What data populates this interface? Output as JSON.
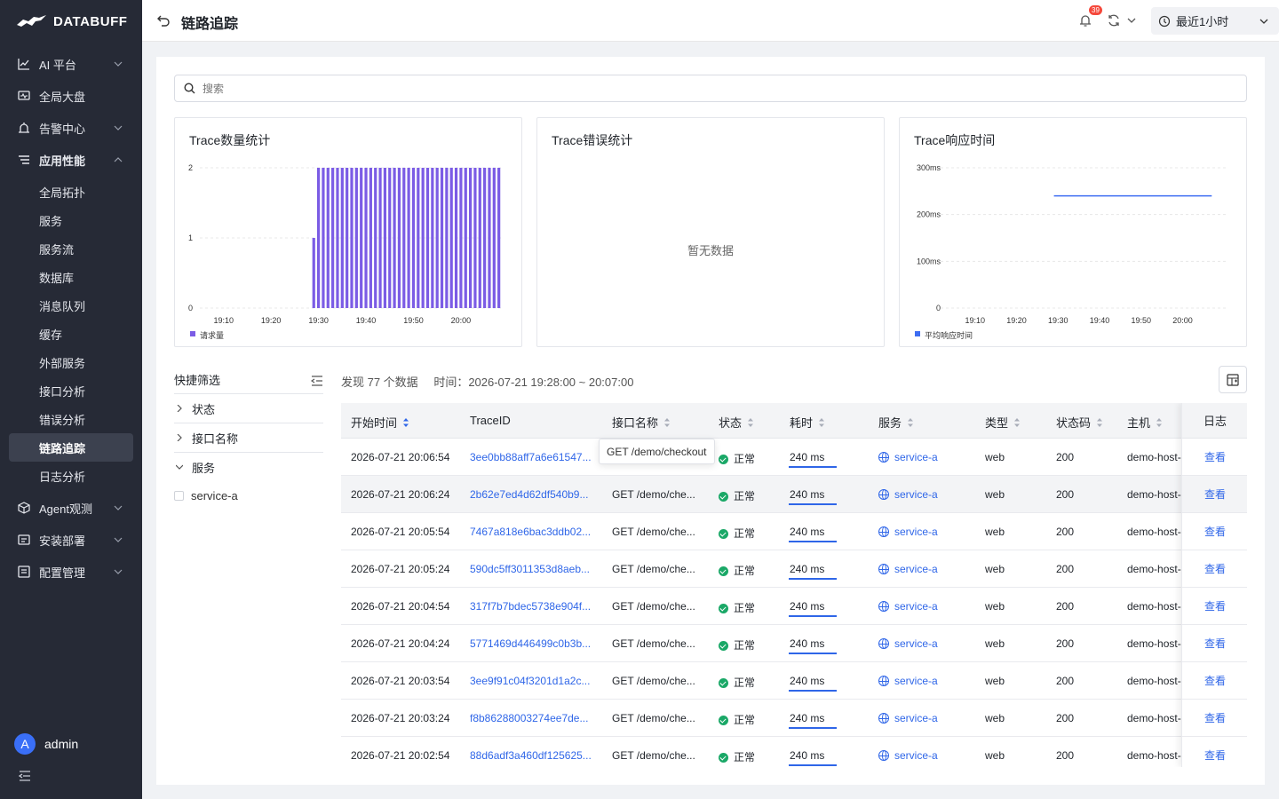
{
  "app": {
    "brand": "DATABUFF"
  },
  "sidebar": {
    "items": [
      {
        "label": "AI 平台",
        "icon": "chart-icon"
      },
      {
        "label": "全局大盘",
        "icon": "monitor-icon"
      },
      {
        "label": "告警中心",
        "icon": "alarm-icon"
      },
      {
        "label": "应用性能",
        "icon": "list-icon"
      },
      {
        "label": "Agent观测",
        "icon": "cube-icon"
      },
      {
        "label": "安装部署",
        "icon": "deploy-icon"
      },
      {
        "label": "配置管理",
        "icon": "config-icon"
      }
    ],
    "sub_items": [
      "全局拓扑",
      "服务",
      "服务流",
      "数据库",
      "消息队列",
      "缓存",
      "外部服务",
      "接口分析",
      "错误分析",
      "链路追踪",
      "日志分析"
    ],
    "active_sub": "链路追踪",
    "user": {
      "initial": "A",
      "name": "admin"
    }
  },
  "header": {
    "title": "链路追踪",
    "notification_count": "39",
    "time_range": "最近1小时"
  },
  "search": {
    "placeholder": "搜索"
  },
  "cards": {
    "count": {
      "title": "Trace数量统计",
      "legend": "请求量"
    },
    "error": {
      "title": "Trace错误统计",
      "empty": "暂无数据"
    },
    "latency": {
      "title": "Trace响应时间",
      "legend": "平均响应时间"
    }
  },
  "chart_data": [
    {
      "type": "bar",
      "title": "Trace数量统计",
      "x_ticks": [
        "19:10",
        "19:20",
        "19:30",
        "19:40",
        "19:50",
        "20:00"
      ],
      "y_ticks": [
        "0",
        "1",
        "2"
      ],
      "ylim": [
        0,
        2
      ],
      "series": [
        {
          "name": "请求量",
          "values": [
            1,
            2,
            2,
            2,
            2,
            2,
            2,
            2,
            2,
            2,
            2,
            2,
            2,
            2,
            2,
            2,
            2,
            2,
            2,
            2,
            2,
            2,
            2,
            2,
            2,
            2,
            2,
            2,
            2,
            2,
            2,
            2,
            2,
            2,
            2,
            2,
            2,
            2,
            2,
            2
          ],
          "color": "#7b5ce5"
        }
      ]
    },
    {
      "type": "line",
      "title": "Trace错误统计",
      "series": []
    },
    {
      "type": "line",
      "title": "Trace响应时间",
      "x_ticks": [
        "19:10",
        "19:20",
        "19:30",
        "19:40",
        "19:50",
        "20:00"
      ],
      "y_ticks": [
        "0",
        "100ms",
        "200ms",
        "300ms"
      ],
      "ylim": [
        0,
        300
      ],
      "series": [
        {
          "name": "平均响应时间",
          "x_range": [
            "19:29",
            "20:07"
          ],
          "value": 240,
          "color": "#3d6df2"
        }
      ]
    }
  ],
  "filter": {
    "title": "快捷筛选",
    "groups": [
      {
        "label": "状态",
        "expanded": false
      },
      {
        "label": "接口名称",
        "expanded": false
      },
      {
        "label": "服务",
        "expanded": true,
        "options": [
          "service-a"
        ]
      }
    ]
  },
  "summary": {
    "found": "发现 77 个数据",
    "time": "时间：2026-07-21 19:28:00 ~ 20:07:00"
  },
  "table": {
    "columns": [
      "开始时间",
      "TraceID",
      "接口名称",
      "状态",
      "耗时",
      "服务",
      "类型",
      "状态码",
      "主机",
      "日志"
    ],
    "rows": [
      {
        "start": "2026-07-21 20:06:54",
        "trace": "3ee0bb88aff7a6e61547...",
        "api": "GET /demo/checkout",
        "status": "正常",
        "duration": "240 ms",
        "service": "service-a",
        "type": "web",
        "code": "200",
        "host": "demo-host-",
        "log": "查看"
      },
      {
        "start": "2026-07-21 20:06:24",
        "trace": "2b62e7ed4d62df540b9...",
        "api": "GET /demo/che...",
        "status": "正常",
        "duration": "240 ms",
        "service": "service-a",
        "type": "web",
        "code": "200",
        "host": "demo-host-",
        "log": "查看"
      },
      {
        "start": "2026-07-21 20:05:54",
        "trace": "7467a818e6bac3ddb02...",
        "api": "GET /demo/che...",
        "status": "正常",
        "duration": "240 ms",
        "service": "service-a",
        "type": "web",
        "code": "200",
        "host": "demo-host-",
        "log": "查看"
      },
      {
        "start": "2026-07-21 20:05:24",
        "trace": "590dc5ff3011353d8aeb...",
        "api": "GET /demo/che...",
        "status": "正常",
        "duration": "240 ms",
        "service": "service-a",
        "type": "web",
        "code": "200",
        "host": "demo-host-",
        "log": "查看"
      },
      {
        "start": "2026-07-21 20:04:54",
        "trace": "317f7b7bdec5738e904f...",
        "api": "GET /demo/che...",
        "status": "正常",
        "duration": "240 ms",
        "service": "service-a",
        "type": "web",
        "code": "200",
        "host": "demo-host-",
        "log": "查看"
      },
      {
        "start": "2026-07-21 20:04:24",
        "trace": "5771469d446499c0b3b...",
        "api": "GET /demo/che...",
        "status": "正常",
        "duration": "240 ms",
        "service": "service-a",
        "type": "web",
        "code": "200",
        "host": "demo-host-",
        "log": "查看"
      },
      {
        "start": "2026-07-21 20:03:54",
        "trace": "3ee9f91c04f3201d1a2c...",
        "api": "GET /demo/che...",
        "status": "正常",
        "duration": "240 ms",
        "service": "service-a",
        "type": "web",
        "code": "200",
        "host": "demo-host-",
        "log": "查看"
      },
      {
        "start": "2026-07-21 20:03:24",
        "trace": "f8b86288003274ee7de...",
        "api": "GET /demo/che...",
        "status": "正常",
        "duration": "240 ms",
        "service": "service-a",
        "type": "web",
        "code": "200",
        "host": "demo-host-",
        "log": "查看"
      },
      {
        "start": "2026-07-21 20:02:54",
        "trace": "88d6adf3a460df125625...",
        "api": "GET /demo/che...",
        "status": "正常",
        "duration": "240 ms",
        "service": "service-a",
        "type": "web",
        "code": "200",
        "host": "demo-host-",
        "log": "查看"
      }
    ]
  },
  "tooltip": {
    "text": "GET /demo/checkout"
  },
  "colors": {
    "accent": "#2f66e8",
    "bar": "#7b5ce5",
    "line": "#3d6df2",
    "ok": "#1aa867",
    "sidebar": "#262a36"
  }
}
